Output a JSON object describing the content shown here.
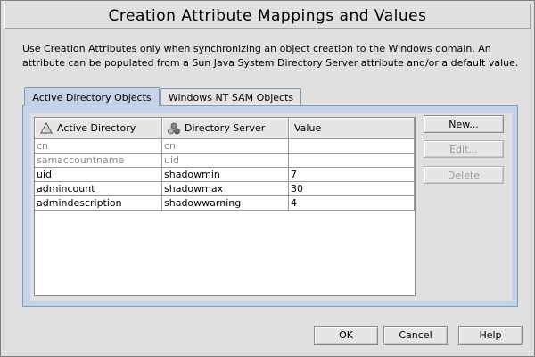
{
  "window": {
    "title": "Creation Attribute Mappings and Values"
  },
  "description": "Use Creation Attributes only when synchronizing an object creation to the Windows domain.  An attribute can be populated from a Sun Java System Directory Server attribute and/or a default value.",
  "tabs": [
    {
      "label": "Active Directory Objects",
      "selected": true
    },
    {
      "label": "Windows NT SAM Objects",
      "selected": false
    }
  ],
  "table": {
    "columns": [
      "Active Directory",
      "Directory Server",
      "Value"
    ],
    "rows": [
      {
        "ad": "cn",
        "ds": "cn",
        "value": "",
        "enabled": false
      },
      {
        "ad": "samaccountname",
        "ds": "uid",
        "value": "",
        "enabled": false
      },
      {
        "ad": "uid",
        "ds": "shadowmin",
        "value": "7",
        "enabled": true
      },
      {
        "ad": "admincount",
        "ds": "shadowmax",
        "value": "30",
        "enabled": true
      },
      {
        "ad": "admindescription",
        "ds": "shadowwarning",
        "value": "4",
        "enabled": true
      }
    ]
  },
  "side_buttons": {
    "new": {
      "label": "New...",
      "enabled": true
    },
    "edit": {
      "label": "Edit...",
      "enabled": false
    },
    "delete": {
      "label": "Delete",
      "enabled": false
    }
  },
  "bottom_buttons": {
    "ok": "OK",
    "cancel": "Cancel",
    "help": "Help"
  },
  "icons": {
    "active_directory_column": "triangle-icon",
    "directory_server_column": "server-nodes-icon"
  },
  "colors": {
    "tab_accent": "#c5d3e8",
    "tab_border": "#7f9db9",
    "background": "#e0e0e0"
  }
}
